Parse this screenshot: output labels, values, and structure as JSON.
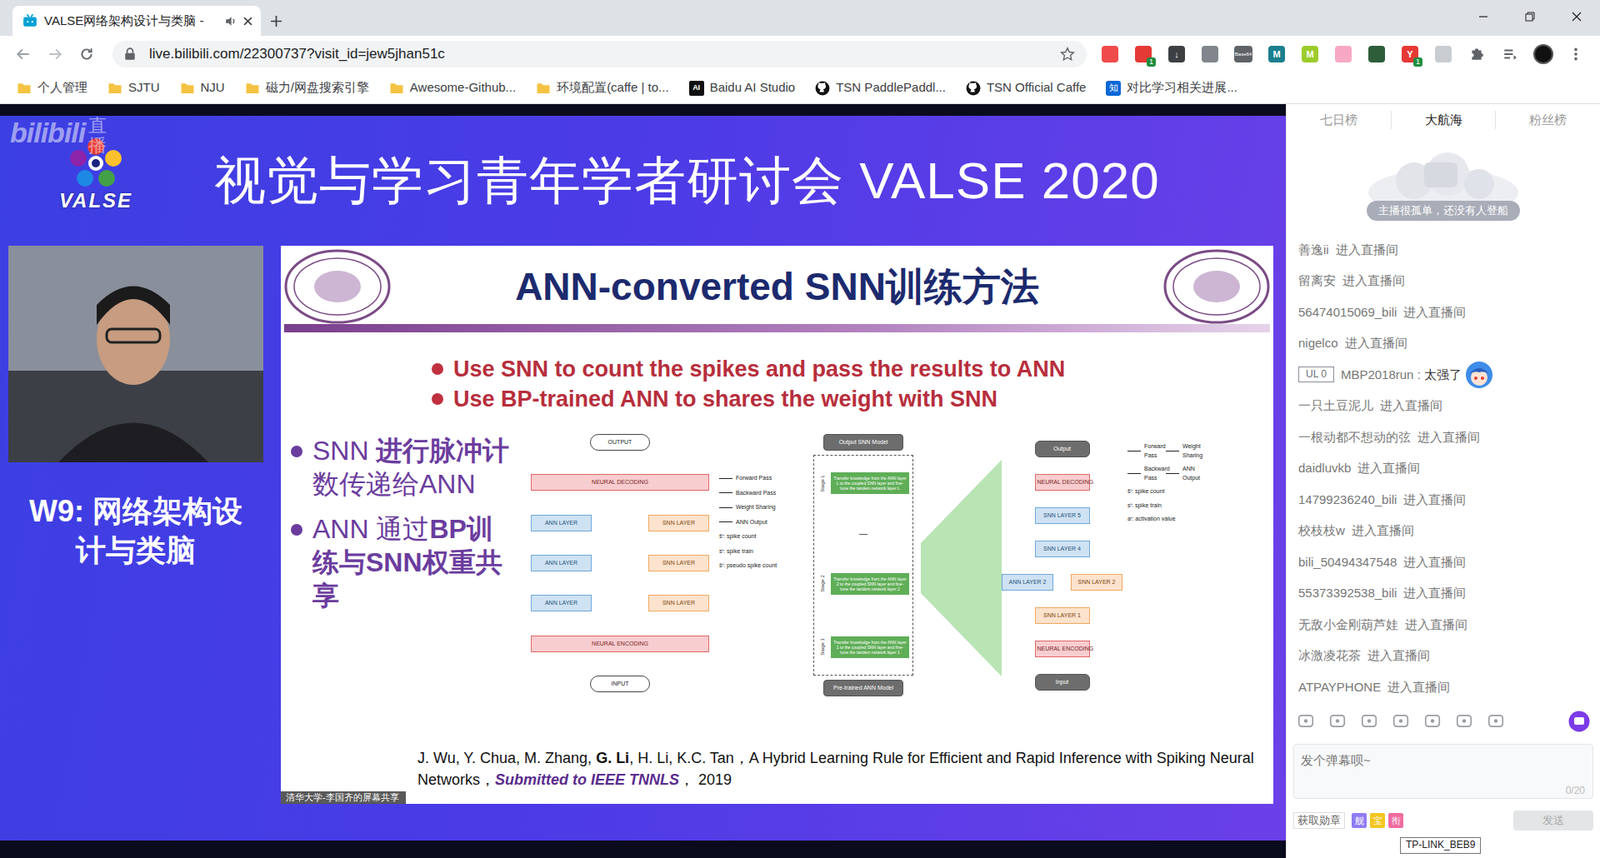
{
  "browser": {
    "tabs": [
      {
        "label": "VALSE网络架构设计与类脑 -",
        "selected": true,
        "playing_audio": true
      }
    ],
    "url": "live.bilibili.com/22300737?visit_id=jew5jhan51c",
    "extensions": [
      {
        "kind": "tile",
        "color": "#f04b4b",
        "icon_text": "",
        "badge": ""
      },
      {
        "kind": "tile",
        "color": "#e53935",
        "icon_text": "",
        "badge": "1"
      },
      {
        "kind": "tile",
        "color": "#3c4043",
        "icon_text": "↓",
        "badge": ""
      },
      {
        "kind": "tile",
        "color": "#80868b",
        "icon_text": "",
        "badge": ""
      },
      {
        "kind": "tile",
        "color": "#5f6368",
        "icon_text": "Base64",
        "badge": ""
      },
      {
        "kind": "tile",
        "color": "#1a7f8e",
        "icon_text": "M",
        "badge": ""
      },
      {
        "kind": "tile",
        "color": "#9ccc2c",
        "icon_text": "M",
        "badge": ""
      },
      {
        "kind": "tile",
        "color": "#f7a8c4",
        "icon_text": "",
        "badge": ""
      },
      {
        "kind": "tile",
        "color": "#2e5d3a",
        "icon_text": "",
        "badge": ""
      },
      {
        "kind": "tile",
        "color": "#e53935",
        "icon_text": "Y",
        "badge": "1"
      },
      {
        "kind": "tile",
        "color": "#c9ccd1",
        "icon_text": "",
        "badge": ""
      },
      {
        "kind": "puzzle",
        "color": "#5f6368",
        "icon_text": "",
        "badge": ""
      },
      {
        "kind": "list",
        "color": "#5f6368",
        "icon_text": "",
        "badge": ""
      }
    ],
    "bookmarks": [
      {
        "label": "个人管理",
        "kind": "folder",
        "icon_text": ""
      },
      {
        "label": "SJTU",
        "kind": "folder",
        "icon_text": ""
      },
      {
        "label": "NJU",
        "kind": "folder",
        "icon_text": ""
      },
      {
        "label": "磁力/网盘搜索引擎",
        "kind": "folder",
        "icon_text": ""
      },
      {
        "label": "Awesome-Github...",
        "kind": "folder",
        "icon_text": ""
      },
      {
        "label": "环境配置(caffe | to...",
        "kind": "folder",
        "icon_text": ""
      },
      {
        "label": "Baidu AI Studio",
        "kind": "ai",
        "icon_text": "AI"
      },
      {
        "label": "TSN PaddlePaddl...",
        "kind": "github",
        "icon_text": ""
      },
      {
        "label": "TSN Official Caffe",
        "kind": "github",
        "icon_text": ""
      },
      {
        "label": "对比学习相关进展...",
        "kind": "zhihu",
        "icon_text": "知"
      }
    ]
  },
  "stream": {
    "watermark": {
      "brand": "bilibili",
      "label": "直播"
    },
    "logo_text": "VALSE",
    "header": "视觉与学习青年学者研讨会 VALSE 2020",
    "session": "W9: 网络架构设计与类脑",
    "share_label": "清华大学-李国齐的屏幕共享",
    "slide": {
      "title": "ANN-converted SNN训练方法",
      "bullets_en": [
        "Use SNN to count the spikes and pass the results to ANN",
        "Use BP-trained ANN to shares the weight with SNN"
      ],
      "bullets_zh": [
        [
          {
            "text": "SNN ",
            "bold": false
          },
          {
            "text": "进行脉冲计",
            "bold": true
          },
          {
            "text": "数传递给ANN",
            "bold": false
          }
        ],
        [
          {
            "text": "ANN 通过",
            "bold": false
          },
          {
            "text": "BP训练",
            "bold": true
          },
          {
            "text": "与SNN权重共享",
            "bold": true
          }
        ]
      ],
      "diagram_a": {
        "rows": [
          [
            {
              "label": "OUTPUT",
              "kind": "pill"
            }
          ],
          [
            {
              "label": "NEURAL DECODING",
              "kind": "codec"
            }
          ],
          [
            {
              "label": "ANN LAYER",
              "kind": "ann"
            },
            {
              "label": "SNN LAYER",
              "kind": "snn"
            }
          ],
          [
            {
              "label": "ANN LAYER",
              "kind": "ann"
            },
            {
              "label": "SNN LAYER",
              "kind": "snn"
            }
          ],
          [
            {
              "label": "ANN LAYER",
              "kind": "ann"
            },
            {
              "label": "SNN LAYER",
              "kind": "snn"
            }
          ],
          [
            {
              "label": "NEURAL ENCODING",
              "kind": "codec"
            }
          ],
          [
            {
              "label": "INPUT",
              "kind": "pill"
            }
          ]
        ],
        "legend": [
          {
            "label": "Forward Pass",
            "kind": "line"
          },
          {
            "label": "Backward Pass",
            "kind": "line"
          },
          {
            "label": "Weight Sharing",
            "kind": "line"
          },
          {
            "label": "ANN Output",
            "kind": "line"
          },
          {
            "label": "s̄ᵗ: spike count",
            "kind": "symbol"
          },
          {
            "label": "sᵗ: spike train",
            "kind": "symbol"
          },
          {
            "label": "ŝᵗ: pseudo spike count",
            "kind": "symbol"
          }
        ]
      },
      "diagram_b": {
        "top": "Output SNN Model",
        "stages": [
          {
            "label": "Stage L",
            "box": "Transfer knowledge from the ANN layer L to the coupled SNN layer and fine-tune the tandem network layer L"
          },
          {
            "label": "Stage 2",
            "box": "Transfer knowledge from the ANN layer 2 to the coupled SNN layer and fine-tune the tandem network layer 2"
          },
          {
            "label": "Stage 1",
            "box": "Transfer knowledge from the ANN layer 1 to the coupled SNN layer and fine-tune the tandem network layer 1"
          }
        ],
        "ellipsis": "—",
        "bottom": "Pre-trained ANN Model"
      },
      "diagram_c": {
        "rows": [
          [
            {
              "label": "Output",
              "kind": "dark"
            }
          ],
          [
            {
              "label": "NEURAL DECODING",
              "kind": "codec"
            }
          ],
          [
            {
              "label": "SNN LAYER 5",
              "kind": "ann"
            }
          ],
          [
            {
              "label": "SNN LAYER 4",
              "kind": "ann"
            }
          ],
          [
            {
              "label": "ANN LAYER 2",
              "kind": "ann"
            },
            {
              "label": "SNN LAYER 2",
              "kind": "snn"
            }
          ],
          [
            {
              "label": "SNN LAYER 1",
              "kind": "snn"
            }
          ],
          [
            {
              "label": "NEURAL ENCODING",
              "kind": "codec"
            }
          ],
          [
            {
              "label": "Input",
              "kind": "dark"
            }
          ]
        ],
        "legend": [
          {
            "label": "Forward Pass",
            "kind": "line"
          },
          {
            "label": "Weight Sharing",
            "kind": "line"
          },
          {
            "label": "Backward Pass",
            "kind": "line"
          },
          {
            "label": "ANN Output",
            "kind": "line"
          },
          {
            "label": "s̄ᵗ: spike count",
            "kind": "symbol"
          },
          {
            "label": "sᵗ: spike train",
            "kind": "symbol"
          },
          {
            "label": "aᵗ: activation value",
            "kind": "symbol"
          }
        ]
      },
      "citation": [
        {
          "text": "J. Wu, Y. Chua, M. Zhang, ",
          "kind": "plain"
        },
        {
          "text": "G. Li",
          "kind": "bold"
        },
        {
          "text": ", H. Li, K.C. Tan，A Hybrid Learning Rule for Efficient and Rapid Inference with Spiking Neural Networks，",
          "kind": "plain"
        },
        {
          "text": "Submitted to IEEE TNNLS",
          "kind": "venue"
        },
        {
          "text": "， 2019",
          "kind": "plain"
        }
      ]
    }
  },
  "chat": {
    "tabs": [
      {
        "label": "七日榜",
        "selected": false
      },
      {
        "label": "大航海",
        "selected": true
      },
      {
        "label": "粉丝榜",
        "selected": false
      }
    ],
    "notice": "主播很孤单，还没有人登船",
    "messages": [
      {
        "kind": "enter",
        "user": "善逸ii",
        "text": "进入直播间"
      },
      {
        "kind": "enter",
        "user": "留离安",
        "text": "进入直播间"
      },
      {
        "kind": "enter",
        "user": "56474015069_bili",
        "text": "进入直播间"
      },
      {
        "kind": "enter",
        "user": "nigelco",
        "text": "进入直播间"
      },
      {
        "kind": "comment",
        "badge": "UL 0",
        "user": "MBP2018run",
        "separator": " : ",
        "text": "太强了"
      },
      {
        "kind": "enter",
        "user": "一只土豆泥儿",
        "text": "进入直播间"
      },
      {
        "kind": "enter",
        "user": "一根动都不想动的弦",
        "text": "进入直播间"
      },
      {
        "kind": "enter",
        "user": "daidluvkb",
        "text": "进入直播间"
      },
      {
        "kind": "enter",
        "user": "14799236240_bili",
        "text": "进入直播间"
      },
      {
        "kind": "enter",
        "user": "校枝枝w",
        "text": "进入直播间"
      },
      {
        "kind": "enter",
        "user": "bili_50494347548",
        "text": "进入直播间"
      },
      {
        "kind": "enter",
        "user": "55373392538_bili",
        "text": "进入直播间"
      },
      {
        "kind": "enter",
        "user": "无敌小金刚葫芦娃",
        "text": "进入直播间"
      },
      {
        "kind": "enter",
        "user": "冰激凌花茶",
        "text": "进入直播间"
      },
      {
        "kind": "enter",
        "user": "ATPAYPHONE",
        "text": "进入直播间"
      }
    ],
    "placeholder": "发个弹幕呗~",
    "counter": "0/20",
    "medal": "获取勋章",
    "badges": [
      {
        "label": "舰",
        "color": "#8e7cf2"
      },
      {
        "label": "宝",
        "color": "#f3c623"
      },
      {
        "label": "衔",
        "color": "#f06ca0"
      }
    ],
    "send": {
      "label": "发送",
      "disabled": true
    },
    "tooltip": "TP-LINK_BEB9"
  }
}
